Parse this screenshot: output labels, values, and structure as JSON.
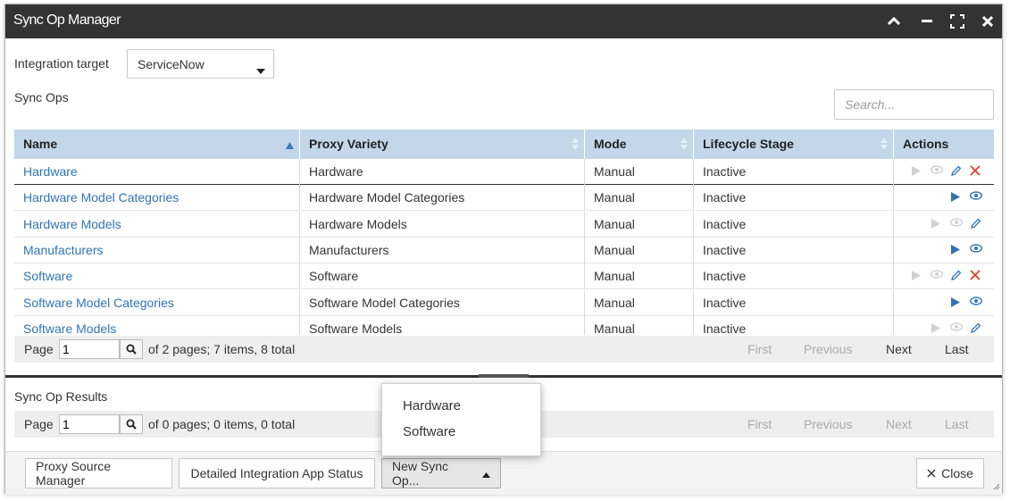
{
  "window": {
    "title": "Sync Op Manager",
    "controls": [
      "chevron-up-icon",
      "minimize-icon",
      "maximize-icon",
      "close-icon"
    ]
  },
  "integration": {
    "label": "Integration target",
    "selected": "ServiceNow"
  },
  "sync_ops": {
    "label": "Sync Ops",
    "search_placeholder": "Search...",
    "columns": {
      "name": "Name",
      "proxy_variety": "Proxy Variety",
      "mode": "Mode",
      "lifecycle": "Lifecycle Stage",
      "actions": "Actions"
    },
    "rows": [
      {
        "name": "Hardware",
        "proxy": "Hardware",
        "mode": "Manual",
        "stage": "Inactive",
        "actions": [
          "play-disabled",
          "view-disabled",
          "edit",
          "delete"
        ]
      },
      {
        "name": "Hardware Model Categories",
        "proxy": "Hardware Model Categories",
        "mode": "Manual",
        "stage": "Inactive",
        "actions": [
          "play",
          "view"
        ]
      },
      {
        "name": "Hardware Models",
        "proxy": "Hardware Models",
        "mode": "Manual",
        "stage": "Inactive",
        "actions": [
          "play-disabled",
          "view-disabled",
          "edit"
        ]
      },
      {
        "name": "Manufacturers",
        "proxy": "Manufacturers",
        "mode": "Manual",
        "stage": "Inactive",
        "actions": [
          "play",
          "view"
        ]
      },
      {
        "name": "Software",
        "proxy": "Software",
        "mode": "Manual",
        "stage": "Inactive",
        "actions": [
          "play-disabled",
          "view-disabled",
          "edit",
          "delete"
        ]
      },
      {
        "name": "Software Model Categories",
        "proxy": "Software Model Categories",
        "mode": "Manual",
        "stage": "Inactive",
        "actions": [
          "play",
          "view"
        ]
      },
      {
        "name": "Software Models",
        "proxy": "Software Models",
        "mode": "Manual",
        "stage": "Inactive",
        "actions": [
          "play-disabled",
          "view-disabled",
          "edit"
        ]
      }
    ],
    "pager": {
      "label": "Page",
      "value": "1",
      "info": "of 2 pages; 7 items, 8 total",
      "first": "First",
      "previous": "Previous",
      "next": "Next",
      "last": "Last"
    }
  },
  "results": {
    "label": "Sync Op Results",
    "pager": {
      "label": "Page",
      "value": "1",
      "info": "of 0 pages; 0 items, 0 total",
      "first": "First",
      "previous": "Previous",
      "next": "Next",
      "last": "Last"
    }
  },
  "footer": {
    "proxy_source_manager": "Proxy Source Manager",
    "detailed_status": "Detailed Integration App Status",
    "new_sync_op": "New Sync Op...",
    "close": "Close"
  },
  "dropdown_menu": {
    "items": [
      "Hardware",
      "Software"
    ]
  },
  "colors": {
    "titlebar": "#333333",
    "header": "#c3d6ea",
    "link": "#2f74b5",
    "play": "#2f74b5",
    "delete": "#e0402a"
  }
}
